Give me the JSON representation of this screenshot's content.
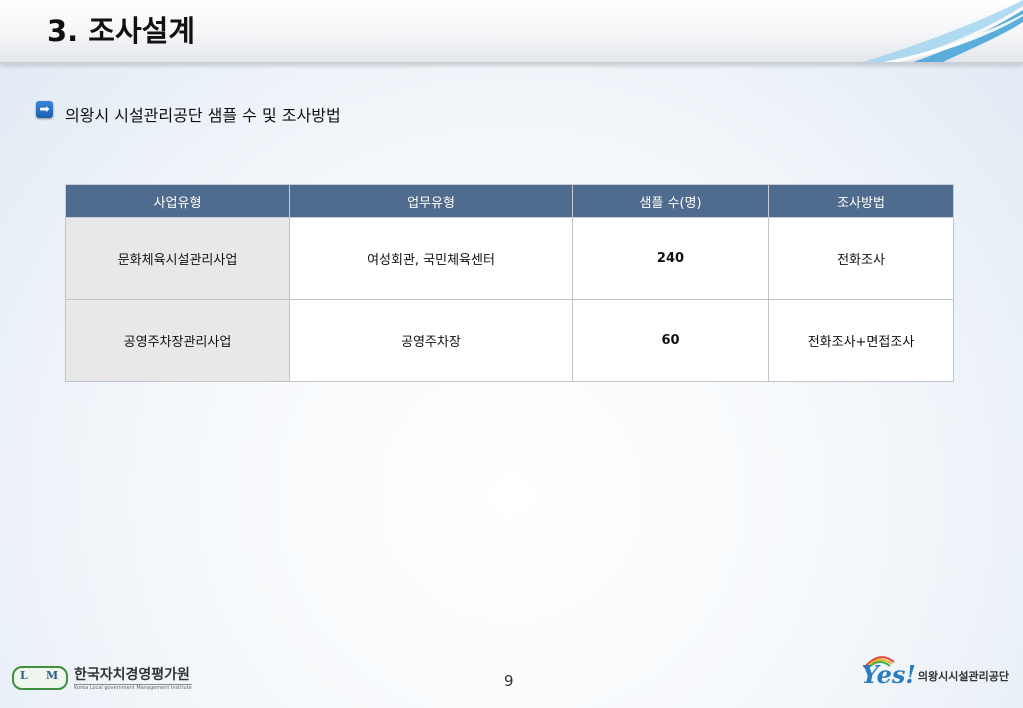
{
  "header": {
    "title": "3. 조사설계"
  },
  "section": {
    "bullet_label": "의왕시 시설관리공단 샘플 수 및 조사방법"
  },
  "table": {
    "headers": [
      "사업유형",
      "업무유형",
      "샘플 수(명)",
      "조사방법"
    ],
    "rows": [
      [
        "문화체육시설관리사업",
        "여성회관, 국민체육센터",
        "240",
        "전화조사"
      ],
      [
        "공영주차장관리사업",
        "공영주차장",
        "60",
        "전화조사+면접조사"
      ]
    ]
  },
  "footer": {
    "org_logo": "L M",
    "org_name": "한국자치경영평가원",
    "org_name_en": "Korea Local government Management Institute",
    "page_number": "9",
    "brand_logo": "Yes!",
    "brand_name": "의왕시시설관리공단"
  },
  "colors": {
    "table_header": "#4f6b8d",
    "first_column": "#e8e8e8",
    "accent": "#2b7bbf"
  }
}
